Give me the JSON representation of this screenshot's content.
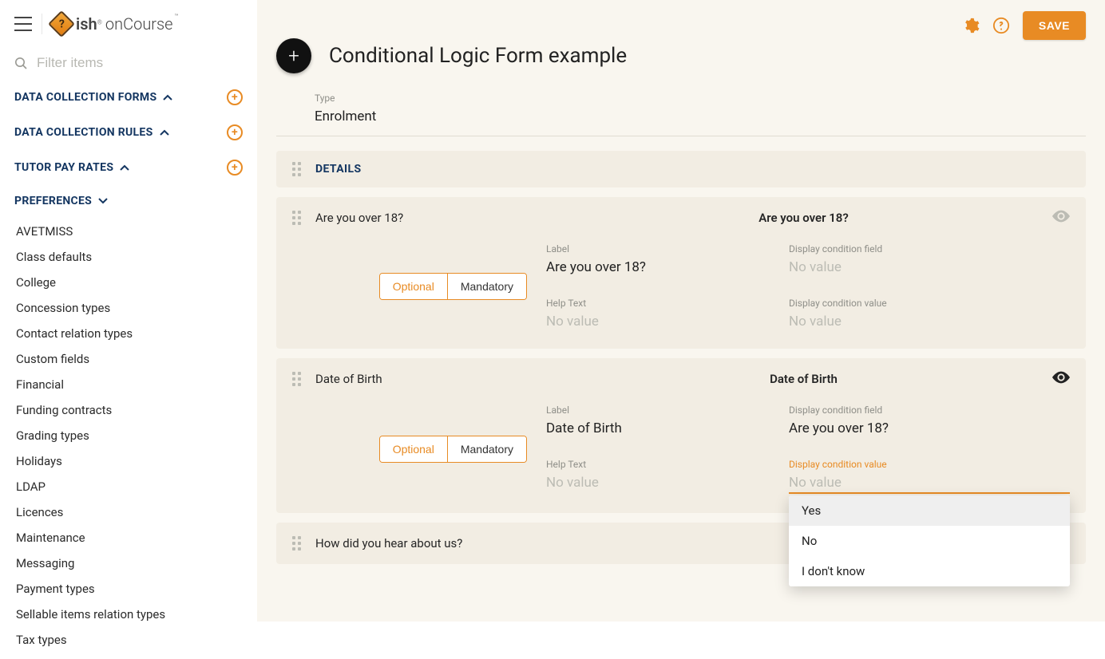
{
  "app": {
    "brand_primary": "ish",
    "brand_secondary": "onCourse",
    "save_label": "SAVE"
  },
  "sidebar": {
    "search_placeholder": "Filter items",
    "sections": [
      {
        "label": "DATA COLLECTION FORMS",
        "expanded": true,
        "add": true
      },
      {
        "label": "DATA COLLECTION RULES",
        "expanded": true,
        "add": true
      },
      {
        "label": "TUTOR PAY RATES",
        "expanded": true,
        "add": true
      },
      {
        "label": "PREFERENCES",
        "expanded": true,
        "add": false
      }
    ],
    "preferences_items": [
      "AVETMISS",
      "Class defaults",
      "College",
      "Concession types",
      "Contact relation types",
      "Custom fields",
      "Financial",
      "Funding contracts",
      "Grading types",
      "Holidays",
      "LDAP",
      "Licences",
      "Maintenance",
      "Messaging",
      "Payment types",
      "Sellable items relation types",
      "Tax types"
    ]
  },
  "page": {
    "title": "Conditional Logic Form example",
    "type_label": "Type",
    "type_value": "Enrolment",
    "section_header": "DETAILS",
    "labels": {
      "label": "Label",
      "help_text": "Help Text",
      "display_condition_field": "Display condition field",
      "display_condition_value": "Display condition value",
      "no_value": "No value",
      "optional": "Optional",
      "mandatory": "Mandatory"
    },
    "fields": [
      {
        "name": "Are you over 18?",
        "title": "Are you over 18?",
        "label_value": "Are you over 18?",
        "help_text": "",
        "condition_field": "",
        "condition_value": "",
        "requirement": "Optional",
        "visible": false
      },
      {
        "name": "Date of Birth",
        "title": "Date of Birth",
        "label_value": "Date of Birth",
        "help_text": "",
        "condition_field": "Are you over 18?",
        "condition_value": "",
        "requirement": "Optional",
        "visible": true
      },
      {
        "name": "How did you hear about us?",
        "title_suffix": "ut us?",
        "visible": false
      }
    ],
    "dropdown_options": [
      "Yes",
      "No",
      "I don't know"
    ]
  },
  "colors": {
    "accent": "#e88b24",
    "panel": "#f2ede3",
    "background": "#f9f6ef"
  }
}
